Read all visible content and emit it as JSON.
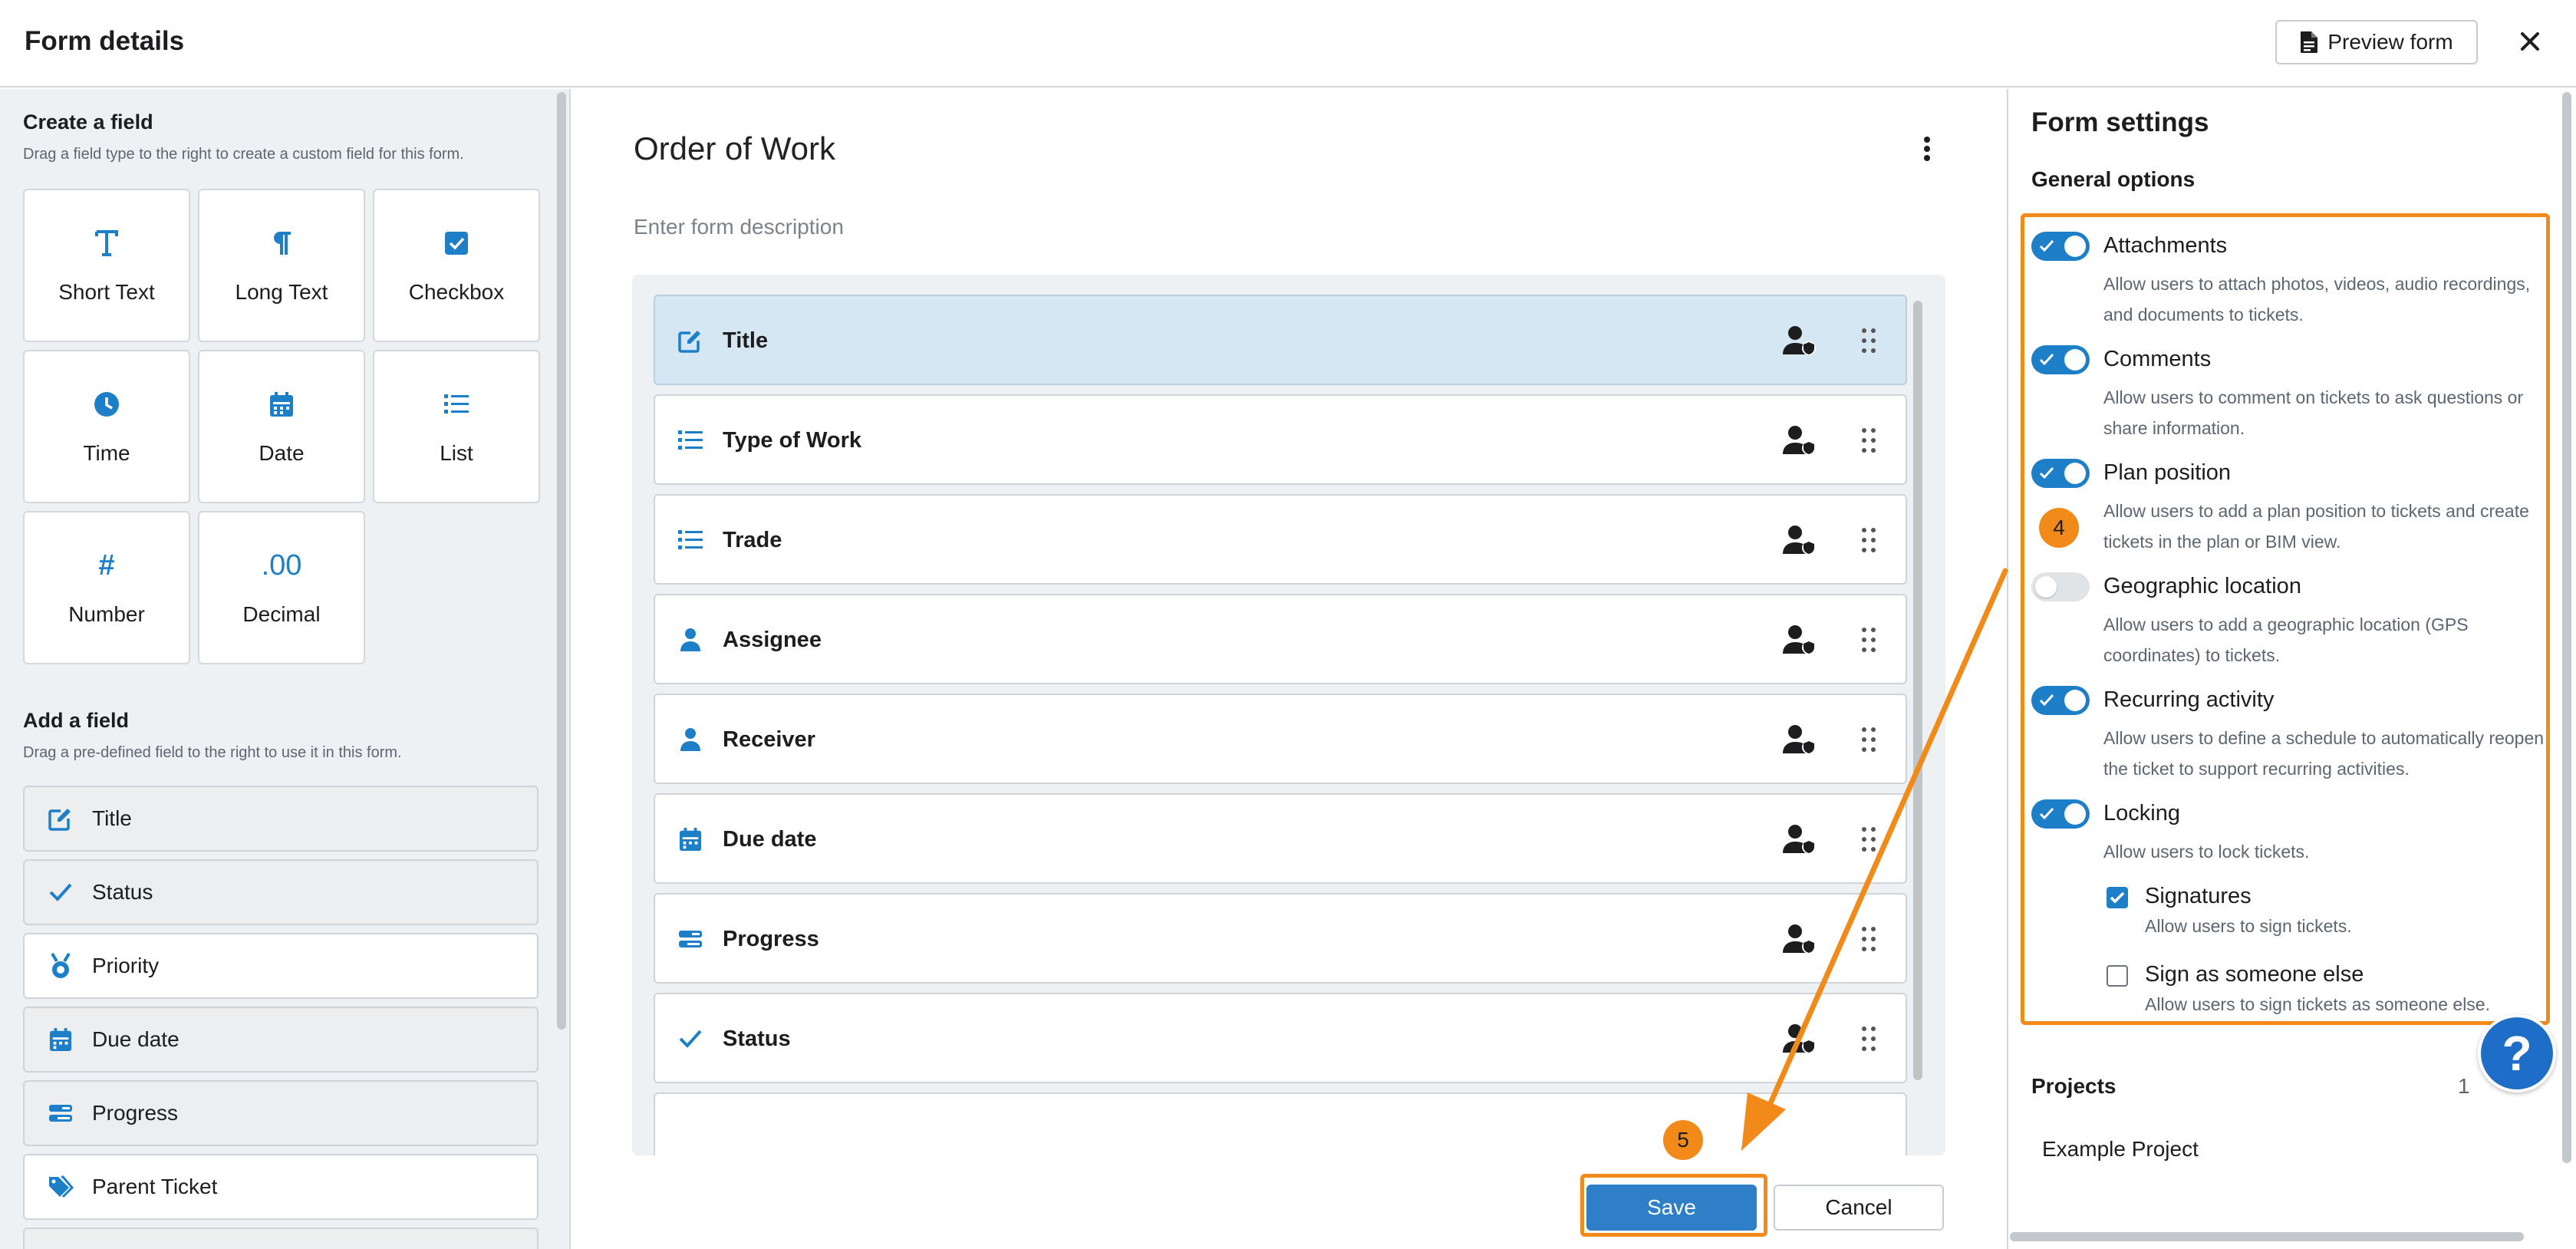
{
  "header": {
    "title": "Form details",
    "preview_label": "Preview form"
  },
  "left": {
    "create_title": "Create a field",
    "create_sub": "Drag a field type to the right to create a custom field for this form.",
    "types": [
      {
        "label": "Short Text",
        "icon": "text-icon"
      },
      {
        "label": "Long Text",
        "icon": "paragraph-icon"
      },
      {
        "label": "Checkbox",
        "icon": "checkbox-icon"
      },
      {
        "label": "Time",
        "icon": "clock-icon"
      },
      {
        "label": "Date",
        "icon": "calendar-icon"
      },
      {
        "label": "List",
        "icon": "list-icon"
      },
      {
        "label": "Number",
        "icon": "hash-icon",
        "glyph": "#"
      },
      {
        "label": "Decimal",
        "icon": "decimal-icon",
        "glyph": ".00"
      }
    ],
    "add_title": "Add a field",
    "add_sub": "Drag a pre-defined field to the right to use it in this form.",
    "predefined": [
      {
        "label": "Title",
        "icon": "edit-icon"
      },
      {
        "label": "Status",
        "icon": "check-icon"
      },
      {
        "label": "Priority",
        "icon": "medal-icon"
      },
      {
        "label": "Due date",
        "icon": "calendar-icon"
      },
      {
        "label": "Progress",
        "icon": "progress-icon"
      },
      {
        "label": "Parent Ticket",
        "icon": "tag-icon"
      }
    ]
  },
  "form": {
    "title": "Order of Work",
    "description_placeholder": "Enter form description",
    "fields": [
      {
        "label": "Title",
        "icon": "edit-icon",
        "selected": true
      },
      {
        "label": "Type of Work",
        "icon": "list-icon"
      },
      {
        "label": "Trade",
        "icon": "list-icon"
      },
      {
        "label": "Assignee",
        "icon": "person-icon"
      },
      {
        "label": "Receiver",
        "icon": "person-icon"
      },
      {
        "label": "Due date",
        "icon": "calendar-icon"
      },
      {
        "label": "Progress",
        "icon": "progress-icon"
      },
      {
        "label": "Status",
        "icon": "check-icon"
      }
    ],
    "save_label": "Save",
    "cancel_label": "Cancel"
  },
  "settings": {
    "title": "Form settings",
    "general_title": "General options",
    "options": [
      {
        "title": "Attachments",
        "desc": "Allow users to attach photos, videos, audio recordings, and documents to tickets.",
        "on": true
      },
      {
        "title": "Comments",
        "desc": "Allow users to comment on tickets to ask questions or share information.",
        "on": true
      },
      {
        "title": "Plan position",
        "desc": "Allow users to add a plan position to tickets and create tickets in the plan or BIM view.",
        "on": true
      },
      {
        "title": "Geographic location",
        "desc": "Allow users to add a geographic location (GPS coordinates) to tickets.",
        "on": false
      },
      {
        "title": "Recurring activity",
        "desc": "Allow users to define a schedule to automatically reopen the ticket to support recurring activities.",
        "on": true
      },
      {
        "title": "Locking",
        "desc": "Allow users to lock tickets.",
        "on": true
      }
    ],
    "signatures": {
      "title": "Signatures",
      "desc": "Allow users to sign tickets.",
      "checked": true
    },
    "sign_else": {
      "title": "Sign as someone else",
      "desc": "Allow users to sign tickets as someone else.",
      "checked": false
    },
    "projects_title": "Projects",
    "projects_count": "1",
    "project_name": "Example Project"
  },
  "annotations": {
    "badge_4": "4",
    "badge_5": "5",
    "accent_color": "#f28a1a"
  },
  "help_label": "?",
  "colors": {
    "primary": "#1e7fc9",
    "save_button": "#2f7fc7",
    "highlight": "#f28a1a",
    "selected_row": "#d6e7f4"
  }
}
